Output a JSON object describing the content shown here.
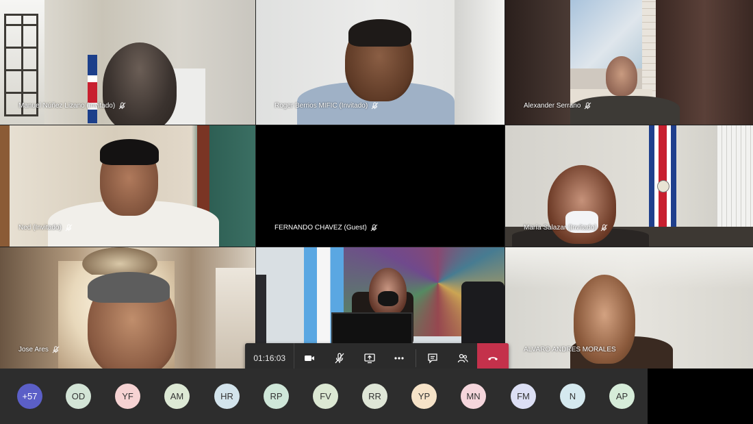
{
  "participants": [
    {
      "name": "Manuel Núñez Lizano (Invitado)"
    },
    {
      "name": "Roger Berrios MIFIC (Invitado)"
    },
    {
      "name": "Alexander Serrano"
    },
    {
      "name": "Ned (Invitado)"
    },
    {
      "name": "FERNANDO CHAVEZ (Guest)"
    },
    {
      "name": "María Salazar (Invitado)"
    },
    {
      "name": "Jose Ares"
    },
    {
      "name": ""
    },
    {
      "name": "ALVARO ANDRES MORALES"
    }
  ],
  "controls": {
    "timer": "01:16:03",
    "camera_icon": "camera-icon",
    "mic_icon": "mic-off-icon",
    "share_icon": "share-screen-icon",
    "more_icon": "more-options-icon",
    "chat_icon": "chat-icon",
    "people_icon": "participants-icon",
    "hangup_icon": "hang-up-icon",
    "hangup_color": "#c4314b"
  },
  "strip": {
    "overflow": "+57",
    "avatars": [
      "OD",
      "YF",
      "AM",
      "HR",
      "RP",
      "FV",
      "RR",
      "YP",
      "MN",
      "FM",
      "N",
      "AP"
    ]
  }
}
